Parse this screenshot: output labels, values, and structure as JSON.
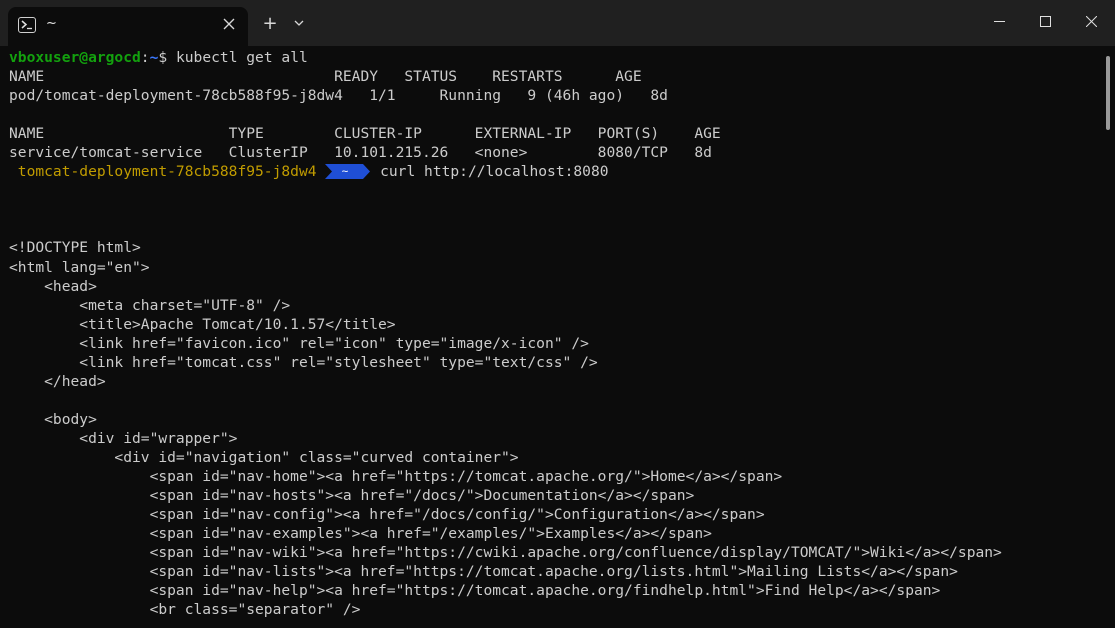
{
  "window": {
    "tab_title": "~",
    "new_tab": "+"
  },
  "terminal": {
    "prompt": {
      "user_host": "vboxuser@argocd",
      "sep": ":",
      "path": "~",
      "symbol": "$",
      "command": " kubectl get all"
    },
    "pods_table": {
      "header": "NAME                                 READY   STATUS    RESTARTS      AGE",
      "row": "pod/tomcat-deployment-78cb588f95-j8dw4   1/1     Running   9 (46h ago)   8d"
    },
    "services_table": {
      "header": "NAME                     TYPE        CLUSTER-IP      EXTERNAL-IP   PORT(S)    AGE",
      "row": "service/tomcat-service   ClusterIP   10.101.215.26   <none>        8080/TCP   8d"
    },
    "prompt2": {
      "pod": " tomcat-deployment-78cb588f95-j8dw4 ",
      "dir": " ~ ",
      "command": " curl http://localhost:8080"
    },
    "output_lines": [
      "<!DOCTYPE html>",
      "<html lang=\"en\">",
      "    <head>",
      "        <meta charset=\"UTF-8\" />",
      "        <title>Apache Tomcat/10.1.57</title>",
      "        <link href=\"favicon.ico\" rel=\"icon\" type=\"image/x-icon\" />",
      "        <link href=\"tomcat.css\" rel=\"stylesheet\" type=\"text/css\" />",
      "    </head>",
      "",
      "    <body>",
      "        <div id=\"wrapper\">",
      "            <div id=\"navigation\" class=\"curved container\">",
      "                <span id=\"nav-home\"><a href=\"https://tomcat.apache.org/\">Home</a></span>",
      "                <span id=\"nav-hosts\"><a href=\"/docs/\">Documentation</a></span>",
      "                <span id=\"nav-config\"><a href=\"/docs/config/\">Configuration</a></span>",
      "                <span id=\"nav-examples\"><a href=\"/examples/\">Examples</a></span>",
      "                <span id=\"nav-wiki\"><a href=\"https://cwiki.apache.org/confluence/display/TOMCAT/\">Wiki</a></span>",
      "                <span id=\"nav-lists\"><a href=\"https://tomcat.apache.org/lists.html\">Mailing Lists</a></span>",
      "                <span id=\"nav-help\"><a href=\"https://tomcat.apache.org/findhelp.html\">Find Help</a></span>",
      "                <br class=\"separator\" />"
    ]
  },
  "colors": {
    "background": "#0c0c0c",
    "titlebar": "#202020",
    "prompt_user": "#13a10e",
    "prompt_path": "#3b78ff",
    "pod_segment": "#c19c00",
    "dir_segment": "#1f4fd6"
  }
}
